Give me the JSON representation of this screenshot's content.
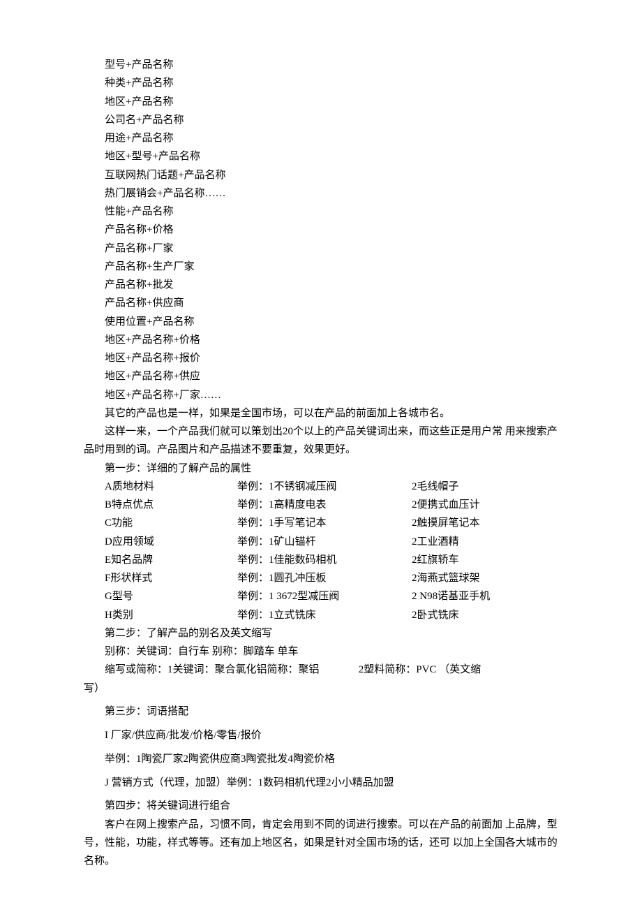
{
  "patterns": [
    "型号+产品名称",
    "种类+产品名称",
    "地区+产品名称",
    "公司名+产品名称",
    "用途+产品名称",
    "地区+型号+产品名称",
    "互联网热门话题+产品名称",
    "热门展销会+产品名称……",
    "性能+产品名称",
    "产品名称+价格",
    "产品名称+厂家",
    "产品名称+生产厂家",
    "产品名称+批发",
    "产品名称+供应商",
    "使用位置+产品名称",
    "地区+产品名称+价格",
    "地区+产品名称+报价",
    "地区+产品名称+供应",
    "地区+产品名称+厂家……"
  ],
  "after_patterns_1": "其它的产品也是一样，如果是全国市场，可以在产品的前面加上各城市名。",
  "after_patterns_2": "这样一来，一个产品我们就可以策划出20个以上的产品关键词出来，而这些正是用户常 用来搜索产品时用到的词。产品图片和产品描述不要重复，效果更好。",
  "step1_title": "第一步：详细的了解产品的属性",
  "attrs": [
    {
      "c1": "A质地材料",
      "c2": "举例：1不锈钢减压阀",
      "c3": "2毛线帽子"
    },
    {
      "c1": "B特点优点",
      "c2": "举例：1高精度电表",
      "c3": "2便携式血压计"
    },
    {
      "c1": "C功能",
      "c2": "举例：1手写笔记本",
      "c3": "2触摸屏笔记本"
    },
    {
      "c1": "D应用领域",
      "c2": "举例：1矿山锚杆",
      "c3": "2工业酒精"
    },
    {
      "c1": "E知名品牌",
      "c2": "举例：1佳能数码相机",
      "c3": "2红旗轿车"
    },
    {
      "c1": "F形状样式",
      "c2": "举例：1圆孔冲压板",
      "c3": "2海燕式篮球架"
    },
    {
      "c1": "G型号",
      "c2": "举例：1 3672型减压阀",
      "c3": "2 N98诺基亚手机"
    },
    {
      "c1": "H类别",
      "c2": "举例：1立式铣床",
      "c3": "2卧式铣床"
    }
  ],
  "step2_title": "第二步：了解产品的别名及英文缩写",
  "step2_line1": "别称：关键词：自行车  别称：脚踏车  单车",
  "step2_line2a": "缩写或简称：1关键词：聚合氯化铝简称：聚铝",
  "step2_line2b": "2塑料简称：PVC （英文缩",
  "step2_line2c": "写）",
  "step3_title": "第三步：词语搭配",
  "step3_line1": "I 厂家/供应商/批发/价格/零售/报价",
  "step3_line2": "举例：1陶瓷厂家2陶瓷供应商3陶瓷批发4陶瓷价格",
  "step3_line3": "J 营销方式（代理，加盟）举例：1数码相机代理2小小精品加盟",
  "step4_title": "第四步：将关键词进行组合",
  "step4_para": "客户在网上搜索产品，习惯不同，肯定会用到不同的词进行搜索。可以在产品的前面加 上品牌，型号，性能，功能，样式等等。还有加上地区名，如果是针对全国市场的话，还可 以加上全国各大城市的名称。"
}
